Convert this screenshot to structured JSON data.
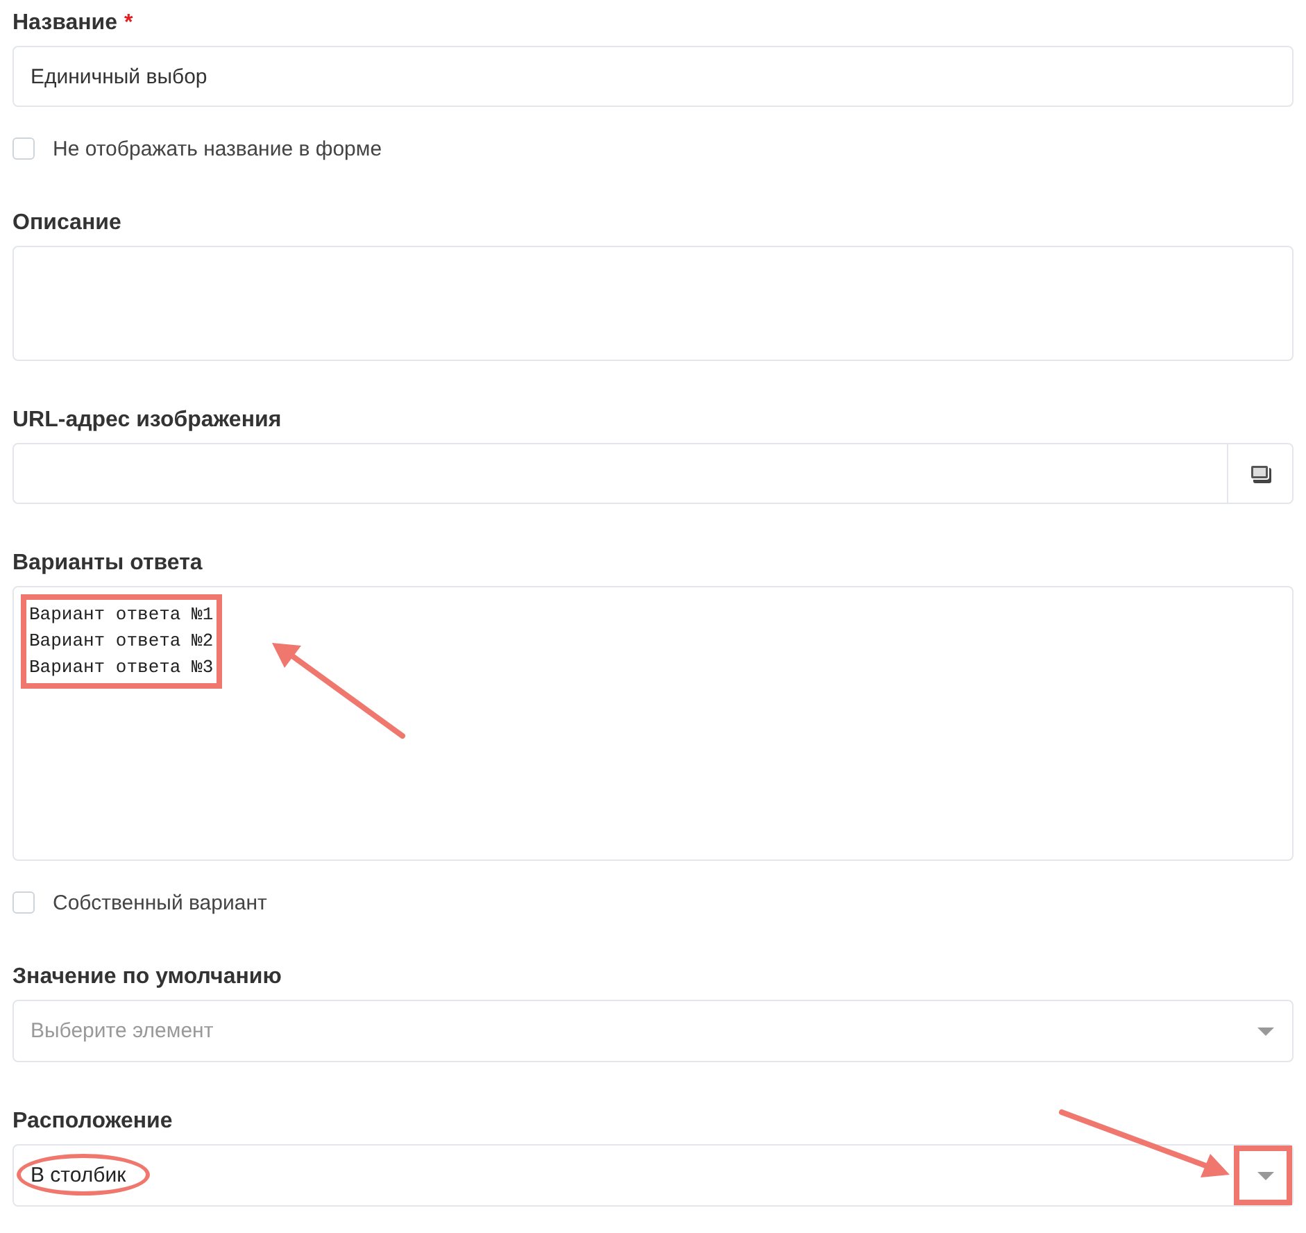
{
  "fields": [
    {
      "kind": "text",
      "label": "Название",
      "required_mark": "*",
      "value": "Единичный выбор"
    },
    {
      "kind": "checkbox",
      "label": "Не отображать название в форме",
      "checked": false
    },
    {
      "kind": "textarea",
      "label": "Описание"
    },
    {
      "kind": "url",
      "label": "URL-адрес изображения"
    },
    {
      "kind": "textarea",
      "label": "Варианты ответа",
      "lines": [
        "Вариант ответа №1",
        "Вариант ответа №2",
        "Вариант ответа №3"
      ]
    },
    {
      "kind": "checkbox",
      "label": "Собственный вариант",
      "checked": false
    },
    {
      "kind": "select",
      "label": "Значение по умолчанию",
      "placeholder": "Выберите элемент"
    },
    {
      "kind": "select",
      "label": "Расположение",
      "value": "В столбик"
    }
  ]
}
